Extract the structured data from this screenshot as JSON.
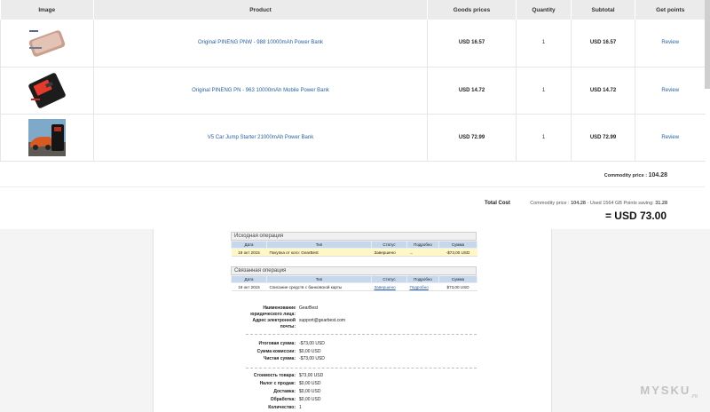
{
  "order": {
    "headers": {
      "image": "Image",
      "product": "Product",
      "price": "Goods prices",
      "quantity": "Quantity",
      "subtotal": "Subtotal",
      "points": "Get points"
    },
    "rows": [
      {
        "image": "silver-power-bank",
        "name": "Original PINENG PNW - 988 10000mAh Power Bank",
        "price": "USD 16.57",
        "qty": "1",
        "subtotal": "USD 16.57",
        "action": "Review"
      },
      {
        "image": "black-red-power-bank",
        "name": "Original PINENG PN - 963 10000mAh Mobile Power Bank",
        "price": "USD 14.72",
        "qty": "1",
        "subtotal": "USD 14.72",
        "action": "Review"
      },
      {
        "image": "car-jump-starter",
        "name": "V5 Car Jump Starter 21000mAh Power Bank",
        "price": "USD 72.99",
        "qty": "1",
        "subtotal": "USD 72.99",
        "action": "Review"
      }
    ],
    "commodity_label": "Commodity price :",
    "commodity_value": "104.28",
    "total_label": "Total Cost",
    "total_breakdown_1": "Commodity price :",
    "total_breakdown_value1": "104.28",
    "total_breakdown_2": "- Used 1564 GB Points saving:",
    "total_breakdown_value2": "31.28",
    "grand_total": "= USD 73.00"
  },
  "receipt": {
    "original": {
      "title": "Исходная операция",
      "headers": [
        "Дата",
        "Тип",
        "Статус",
        "Подробно",
        "Сумма"
      ],
      "row": [
        "19 окт 2015",
        "Покупка от кого: GearBest",
        "Завершено",
        "...",
        "-$73,00 USD"
      ]
    },
    "related": {
      "title": "Связанная операция",
      "headers": [
        "Дата",
        "Тип",
        "Статус",
        "Подробно",
        "Сумма"
      ],
      "row": [
        "19 окт 2015",
        "Списание средств с банковской карты",
        "Завершено",
        "Подробно",
        "$73,00 USD"
      ]
    },
    "legal_name_label": "Наименование юридического лица:",
    "legal_name": "GearBest",
    "email_label": "Адрес электронной почты:",
    "email": "support@gearbest.com",
    "total_label": "Итоговая сумма:",
    "total": "-$73,00 USD",
    "fee_label": "Сумма комиссии:",
    "fee": "$0,00 USD",
    "net_label": "Чистая сумма:",
    "net": "-$73,00 USD",
    "cost_label": "Стоимость товара:",
    "cost": "$73,00 USD",
    "tax_label": "Налог с продаж:",
    "tax": "$0,00 USD",
    "shipping_label": "Доставка:",
    "shipping": "$0,00 USD",
    "handling_label": "Обработка:",
    "handling": "$0,00 USD",
    "qty_label": "Количество:",
    "qty": "1"
  },
  "watermark": "MYSKU",
  "watermark_sub": ".ru"
}
